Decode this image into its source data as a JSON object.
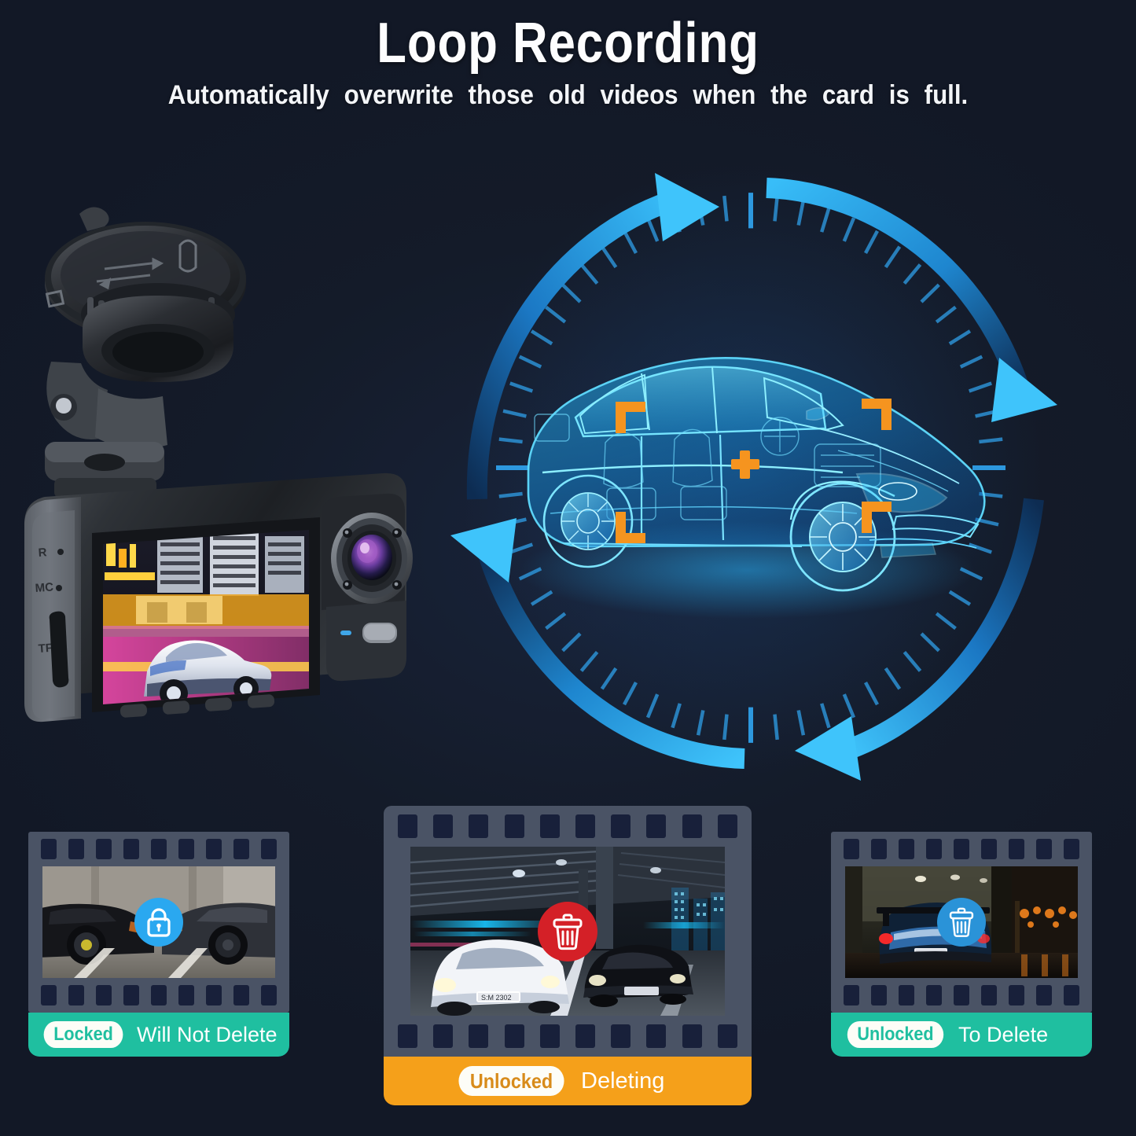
{
  "header": {
    "title": "Loop Recording",
    "subtitle": "Automatically overwrite those old videos when the card is full."
  },
  "colors": {
    "background": "#161d2b",
    "accent_blue": "#2aa8f0",
    "hologram_blue": "#19b5ff",
    "marker_orange": "#f5941f",
    "teal": "#1fbfa0",
    "orange_bar": "#f5a01a",
    "delete_red": "#d42027",
    "film_frame": "#4a5365",
    "sprocket": "#18203a"
  },
  "device": {
    "name": "dash-camera",
    "side_labels": [
      "R",
      "MC",
      "TF"
    ],
    "screen_scene": "night-city-with-white-sports-car",
    "mount": "suction-cup-mount",
    "lens": "front-camera-lens-with-ir-leds"
  },
  "loop_graphic": {
    "name": "loop-recording-ring",
    "arrow_count": 4,
    "tick_count": 60,
    "label": "continuous loop arrows"
  },
  "hologram": {
    "name": "car-xray-hologram",
    "focus_brackets": 4,
    "crosshair": "+"
  },
  "panels": [
    {
      "id": "locked",
      "name": "panel-locked",
      "icon": "lock-icon",
      "icon_color": "#2aa8f0",
      "icon_style": "blue-circle",
      "badge_label": "Locked",
      "badge_text_color": "#1fbfa0",
      "caption_text": "Will Not Delete",
      "bar_color": "#1fbfa0",
      "scene": "two-parked-sports-cars-in-garage"
    },
    {
      "id": "deleting",
      "name": "panel-deleting",
      "icon": "trash-icon",
      "icon_color": "#d42027",
      "icon_style": "red-circle",
      "badge_label": "Unlocked",
      "badge_text_color": "#e09020",
      "caption_text": "Deleting",
      "bar_color": "#f5a01a",
      "scene": "white-and-black-cars-under-overpass"
    },
    {
      "id": "to-delete",
      "name": "panel-to-delete",
      "icon": "trash-icon",
      "icon_color": "#2a93d8",
      "icon_style": "blue-circle",
      "badge_label": "Unlocked",
      "badge_text_color": "#1fbfa0",
      "caption_text": "To Delete",
      "bar_color": "#1fbfa0",
      "scene": "blue-car-rear-at-night-in-rain"
    }
  ]
}
